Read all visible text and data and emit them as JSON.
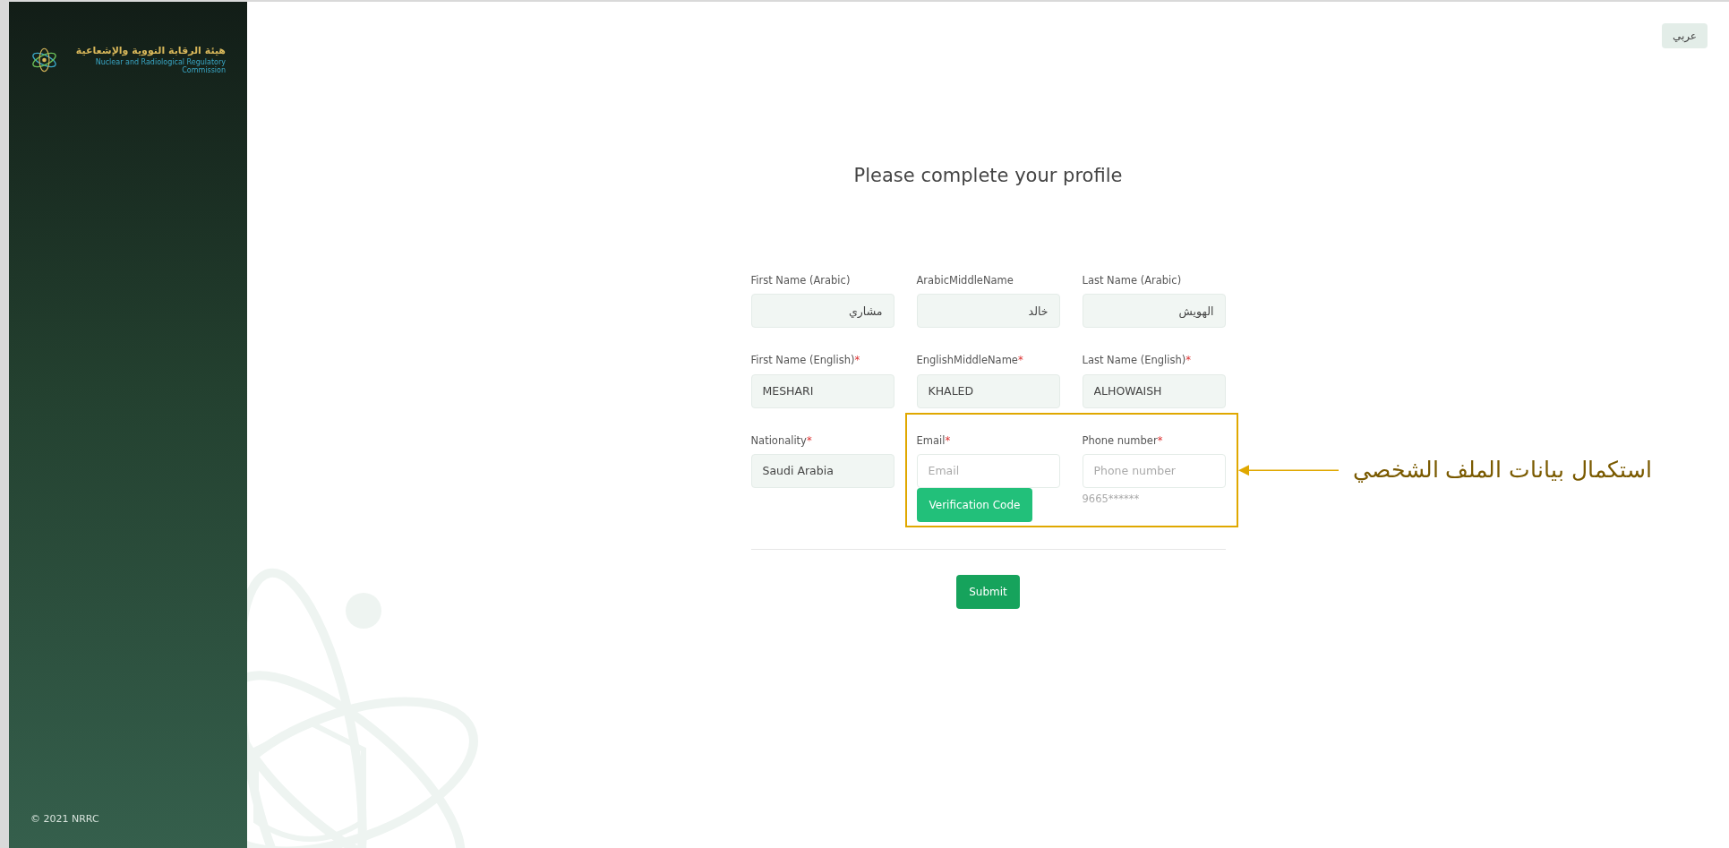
{
  "sidebar": {
    "logo_title_ar": "هيئة الرقابة النووية والإشعاعية",
    "logo_title_en": "Nuclear and Radiological Regulatory Commission",
    "footer": "© 2021 NRRC"
  },
  "language_button": "عربي",
  "title": "Please complete your profile",
  "fields": [
    {
      "label": "First Name (Arabic)",
      "value": "مشاري",
      "disabled": true
    },
    {
      "label": "ArabicMiddleName",
      "value": "خالد",
      "disabled": true
    },
    {
      "label": "Last Name (Arabic)",
      "value": "الهويش",
      "disabled": true
    },
    {
      "label": "First Name (English)",
      "required_mark": "*",
      "value": "MESHARI",
      "disabled": true
    },
    {
      "label": "EnglishMiddleName",
      "required_mark": "*",
      "value": "KHALED",
      "disabled": true
    },
    {
      "label": "Last Name (English)",
      "required_mark": "*",
      "value": "ALHOWAISH",
      "disabled": true
    },
    {
      "label": "Nationality",
      "required_mark": "*",
      "value": "Saudi Arabia",
      "disabled": true
    },
    {
      "label": "Email",
      "required_mark": "*",
      "placeholder": "Email",
      "disabled": false,
      "button": "Verification Code"
    },
    {
      "label": "Phone number",
      "required_mark": "*",
      "placeholder": "Phone number",
      "disabled": false,
      "hint": "9665******"
    }
  ],
  "submit_button": "Submit",
  "annotation": {
    "text": "استكمال بيانات الملف الشخصي"
  }
}
